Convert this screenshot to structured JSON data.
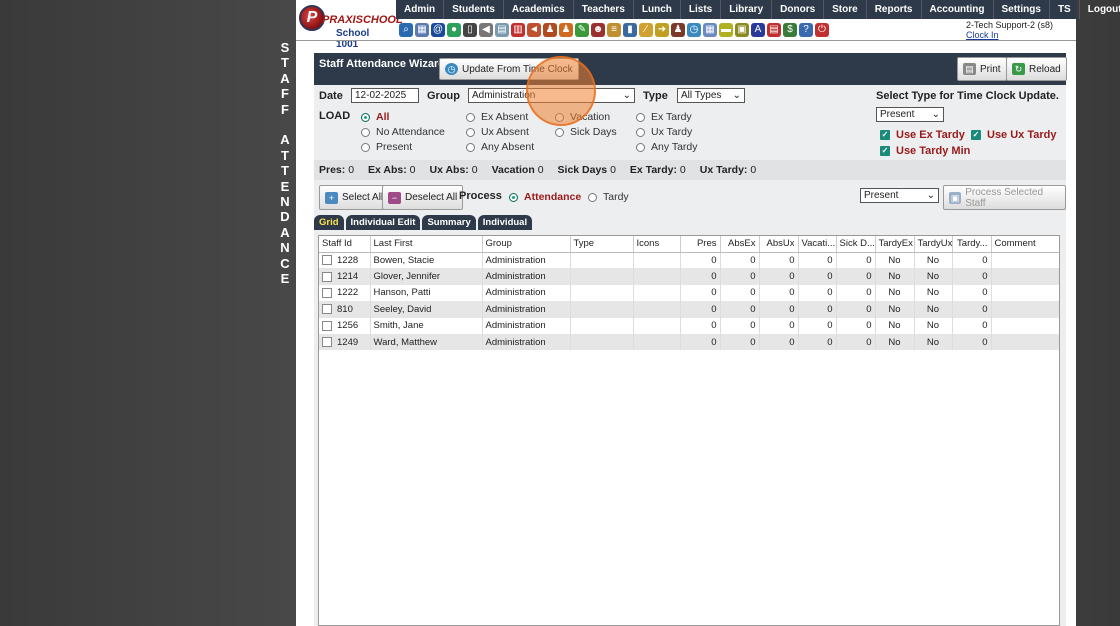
{
  "side_label": [
    "S",
    "T",
    "A",
    "F",
    "F",
    "",
    "A",
    "T",
    "T",
    "E",
    "N",
    "D",
    "A",
    "N",
    "C",
    "E"
  ],
  "logo": {
    "brand": "PRAXISCHOOL",
    "letter": "P",
    "school": "School 1001"
  },
  "menu": [
    "Admin",
    "Students",
    "Academics",
    "Teachers",
    "Lunch",
    "Lists",
    "Library",
    "Donors",
    "Store",
    "Reports",
    "Accounting",
    "Settings",
    "TS",
    "Logout"
  ],
  "toolbar_icons": [
    {
      "name": "search-icon",
      "glyph": "⌕",
      "color": "#2a6ab0"
    },
    {
      "name": "grid-icon",
      "glyph": "▦",
      "color": "#5a7ab0"
    },
    {
      "name": "email-icon",
      "glyph": "@",
      "color": "#1a4a9a"
    },
    {
      "name": "chat-icon",
      "glyph": "●",
      "color": "#2aa05a"
    },
    {
      "name": "phone-icon",
      "glyph": "▯",
      "color": "#444"
    },
    {
      "name": "speaker-icon",
      "glyph": "◀",
      "color": "#777"
    },
    {
      "name": "form-icon",
      "glyph": "▤",
      "color": "#7a9ab0"
    },
    {
      "name": "calendar-icon",
      "glyph": "▥",
      "color": "#c03030"
    },
    {
      "name": "megaphone-icon",
      "glyph": "◄",
      "color": "#c05030"
    },
    {
      "name": "teacher-icon",
      "glyph": "♟",
      "color": "#b04a20"
    },
    {
      "name": "student-icon",
      "glyph": "♟",
      "color": "#d06a20"
    },
    {
      "name": "pencil-icon",
      "glyph": "✎",
      "color": "#3a9a3a"
    },
    {
      "name": "people-icon",
      "glyph": "☻",
      "color": "#9a3030"
    },
    {
      "name": "food-icon",
      "glyph": "≡",
      "color": "#c09030"
    },
    {
      "name": "book-icon",
      "glyph": "▮",
      "color": "#3a6aa0"
    },
    {
      "name": "broom-icon",
      "glyph": "⁄",
      "color": "#d0a030"
    },
    {
      "name": "cart-icon",
      "glyph": "➜",
      "color": "#c0a020"
    },
    {
      "name": "person-icon",
      "glyph": "♟",
      "color": "#7a3a2a"
    },
    {
      "name": "clock-icon",
      "glyph": "◷",
      "color": "#3a8ac0"
    },
    {
      "name": "table-icon",
      "glyph": "▦",
      "color": "#6a8ac0"
    },
    {
      "name": "card-icon",
      "glyph": "▬",
      "color": "#b0b020"
    },
    {
      "name": "register-icon",
      "glyph": "▣",
      "color": "#8a8a20"
    },
    {
      "name": "ap-icon",
      "glyph": "A",
      "color": "#2a3a9a"
    },
    {
      "name": "pdf-icon",
      "glyph": "▤",
      "color": "#c03030"
    },
    {
      "name": "money-icon",
      "glyph": "$",
      "color": "#3a7a3a"
    },
    {
      "name": "help-icon",
      "glyph": "?",
      "color": "#3a6ab0"
    },
    {
      "name": "power-icon",
      "glyph": "⏻",
      "color": "#c03030"
    }
  ],
  "user": {
    "name": "2-Tech Support-2 (s8)",
    "clock_in": "Clock In"
  },
  "wizard": {
    "title": "Staff Attendance Wizard",
    "update_btn": "Update From Time Clock",
    "print_btn": "Print",
    "reload_btn": "Reload"
  },
  "filters": {
    "date_label": "Date",
    "date_value": "12-02-2025",
    "group_label": "Group",
    "group_value": "Administration",
    "type_label": "Type",
    "type_value": "All Types",
    "load_label": "LOAD",
    "timeclock_label": "Select Type for Time Clock Update.",
    "timeclock_value": "Present"
  },
  "load_options": {
    "all": "All",
    "no_attendance": "No Attendance",
    "present": "Present",
    "ex_absent": "Ex Absent",
    "ux_absent": "Ux Absent",
    "any_absent": "Any Absent",
    "vacation": "Vacation",
    "sick_days": "Sick Days",
    "ex_tardy": "Ex Tardy",
    "ux_tardy": "Ux Tardy",
    "any_tardy": "Any Tardy"
  },
  "use_options": {
    "ex_tardy": "Use Ex Tardy",
    "ux_tardy": "Use Ux Tardy",
    "tardy_min": "Use Tardy Min"
  },
  "summary": [
    {
      "label": "Pres:",
      "value": "0"
    },
    {
      "label": "Ex Abs:",
      "value": "0"
    },
    {
      "label": "Ux Abs:",
      "value": "0"
    },
    {
      "label": "Vacation",
      "value": "0"
    },
    {
      "label": "Sick Days",
      "value": "0"
    },
    {
      "label": "Ex Tardy:",
      "value": "0"
    },
    {
      "label": "Ux Tardy:",
      "value": "0"
    }
  ],
  "actions": {
    "select_all": "Select All",
    "deselect_all": "Deselect All",
    "process_label": "Process",
    "attendance": "Attendance",
    "tardy": "Tardy",
    "process_value": "Present",
    "process_selected": "Process Selected Staff"
  },
  "tabs": [
    "Grid",
    "Individual Edit",
    "Summary",
    "Individual"
  ],
  "columns": [
    "Staff Id",
    "Last First",
    "Group",
    "Type",
    "Icons",
    "Pres",
    "AbsEx",
    "AbsUx",
    "Vacati...",
    "Sick D...",
    "TardyEx",
    "TardyUx",
    "Tardy...",
    "Comment"
  ],
  "rows": [
    [
      "1228",
      "Bowen, Stacie",
      "Administration",
      "",
      "",
      "0",
      "0",
      "0",
      "0",
      "0",
      "No",
      "No",
      "0",
      ""
    ],
    [
      "1214",
      "Glover, Jennifer",
      "Administration",
      "",
      "",
      "0",
      "0",
      "0",
      "0",
      "0",
      "No",
      "No",
      "0",
      ""
    ],
    [
      "1222",
      "Hanson, Patti",
      "Administration",
      "",
      "",
      "0",
      "0",
      "0",
      "0",
      "0",
      "No",
      "No",
      "0",
      ""
    ],
    [
      "810",
      "Seeley, David",
      "Administration",
      "",
      "",
      "0",
      "0",
      "0",
      "0",
      "0",
      "No",
      "No",
      "0",
      ""
    ],
    [
      "1256",
      "Smith, Jane",
      "Administration",
      "",
      "",
      "0",
      "0",
      "0",
      "0",
      "0",
      "No",
      "No",
      "0",
      ""
    ],
    [
      "1249",
      "Ward, Matthew",
      "Administration",
      "",
      "",
      "0",
      "0",
      "0",
      "0",
      "0",
      "No",
      "No",
      "0",
      ""
    ]
  ]
}
